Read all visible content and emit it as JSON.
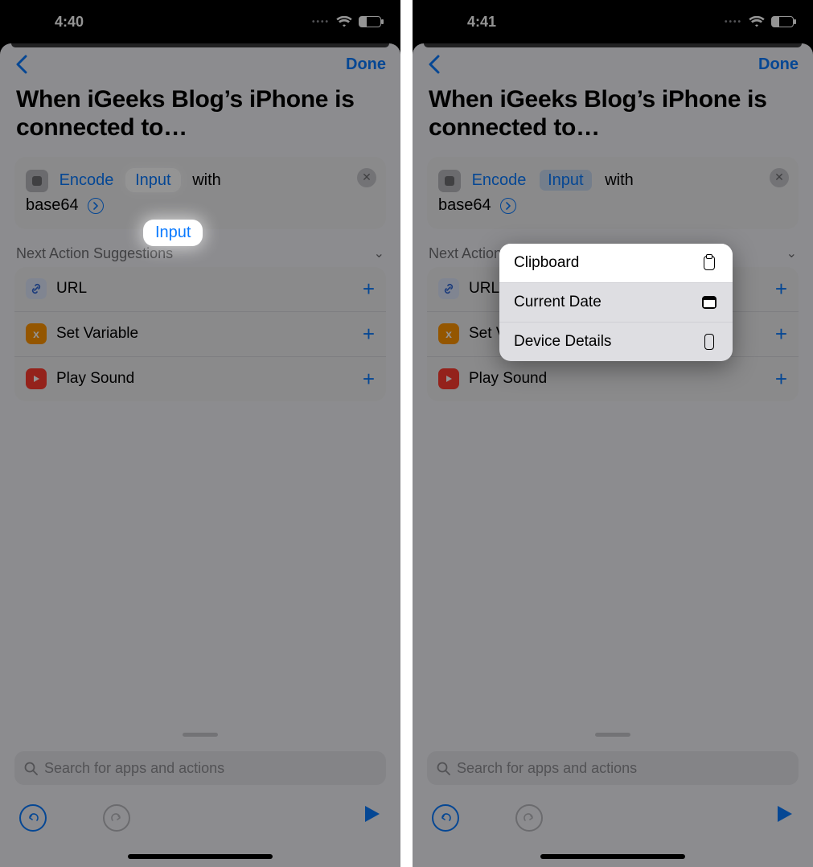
{
  "left": {
    "status": {
      "time": "4:40"
    },
    "nav": {
      "done": "Done"
    },
    "title": "When iGeeks Blog’s iPhone is connected to…",
    "action": {
      "encode": "Encode",
      "input": "Input",
      "with": "with",
      "base64": "base64"
    },
    "suggestions": {
      "header": "Next Action Suggestions",
      "items": [
        {
          "label": "URL"
        },
        {
          "label": "Set Variable"
        },
        {
          "label": "Play Sound"
        }
      ]
    },
    "search_placeholder": "Search for apps and actions"
  },
  "right": {
    "status": {
      "time": "4:41"
    },
    "nav": {
      "done": "Done"
    },
    "title": "When iGeeks Blog’s iPhone is connected to…",
    "action": {
      "encode": "Encode",
      "input": "Input",
      "with": "with",
      "base64": "base64"
    },
    "menu": [
      {
        "label": "Clipboard"
      },
      {
        "label": "Current Date"
      },
      {
        "label": "Device Details"
      }
    ],
    "suggestions": {
      "header": "Next Action Suggestions",
      "items": [
        {
          "label": "URL"
        },
        {
          "label": "Set Variable"
        },
        {
          "label": "Play Sound"
        }
      ]
    },
    "search_placeholder": "Search for apps and actions"
  }
}
